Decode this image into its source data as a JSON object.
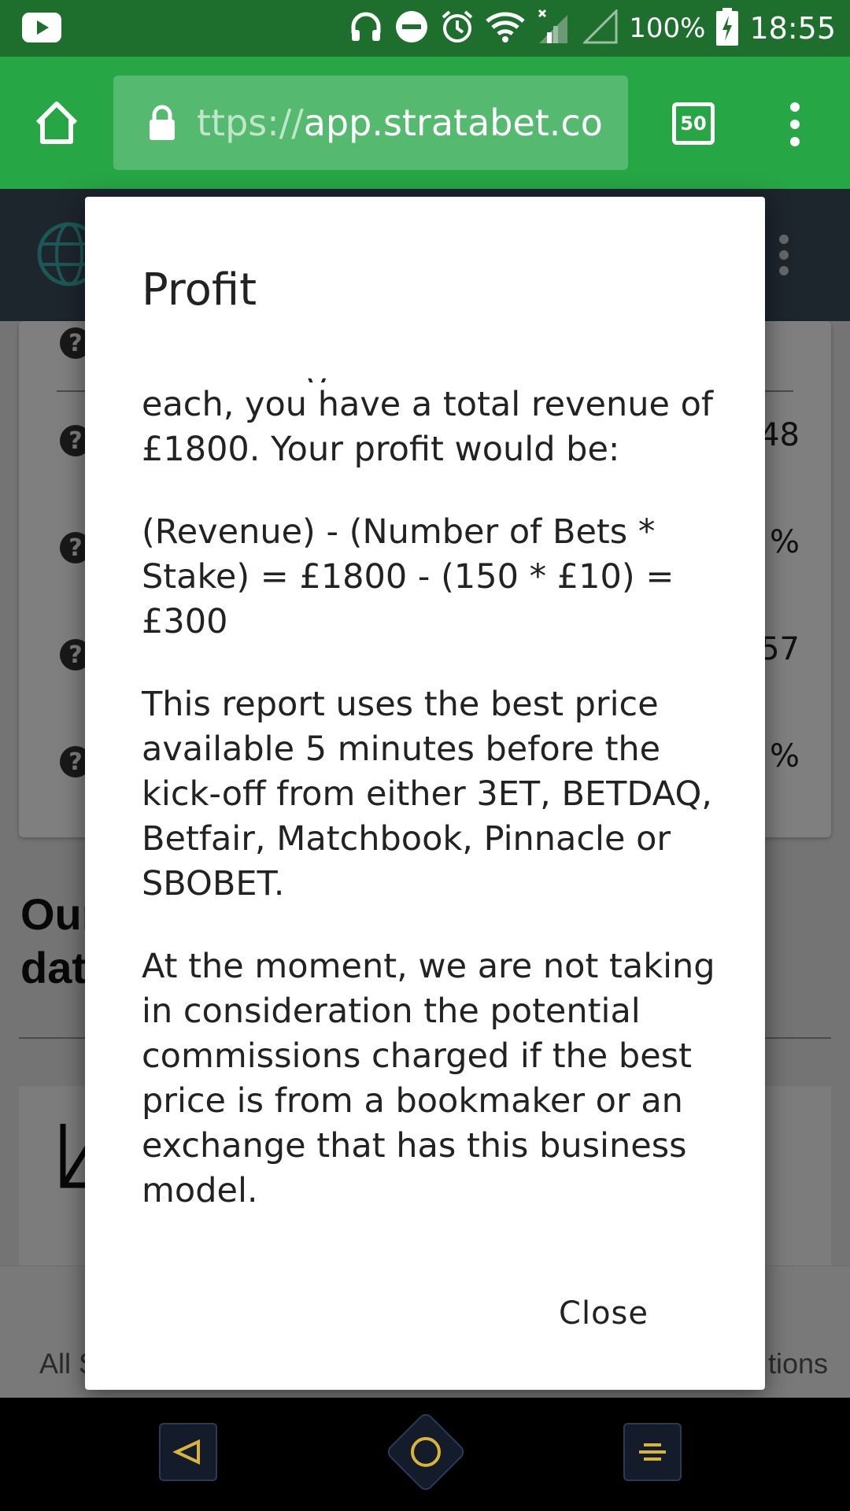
{
  "status_bar": {
    "battery_percent": "100%",
    "time": "18:55",
    "icons": [
      "youtube-icon",
      "headphones-icon",
      "dnd-icon",
      "alarm-icon",
      "wifi-icon",
      "signal-icon",
      "battery-icon"
    ]
  },
  "browser": {
    "url_dim": "ttps://",
    "url_main": "app.stratabet.com",
    "tab_count": "50",
    "theme_color": "#27a645"
  },
  "page": {
    "card_values": [
      "48",
      "%",
      "57",
      "%"
    ],
    "section_heading_line1": "Our",
    "section_heading_line2": "dat",
    "nav_left_label": "All S",
    "nav_right_label": "tions"
  },
  "dialog": {
    "title": "Profit",
    "partial_line": "y",
    "paragraphs": [
      "each, you have a total revenue of £1800. Your profit would be:",
      "(Revenue) - (Number of Bets * Stake) = £1800 - (150 * £10) = £300",
      "This report uses the best price available 5 minutes before the kick-off from either 3ET, BETDAQ, Betfair, Matchbook, Pinnacle or SBOBET.",
      "At the moment, we are not taking in consideration the potential commissions charged if the best price is from a bookmaker or an exchange that has this business model."
    ],
    "close_label": "Close"
  }
}
